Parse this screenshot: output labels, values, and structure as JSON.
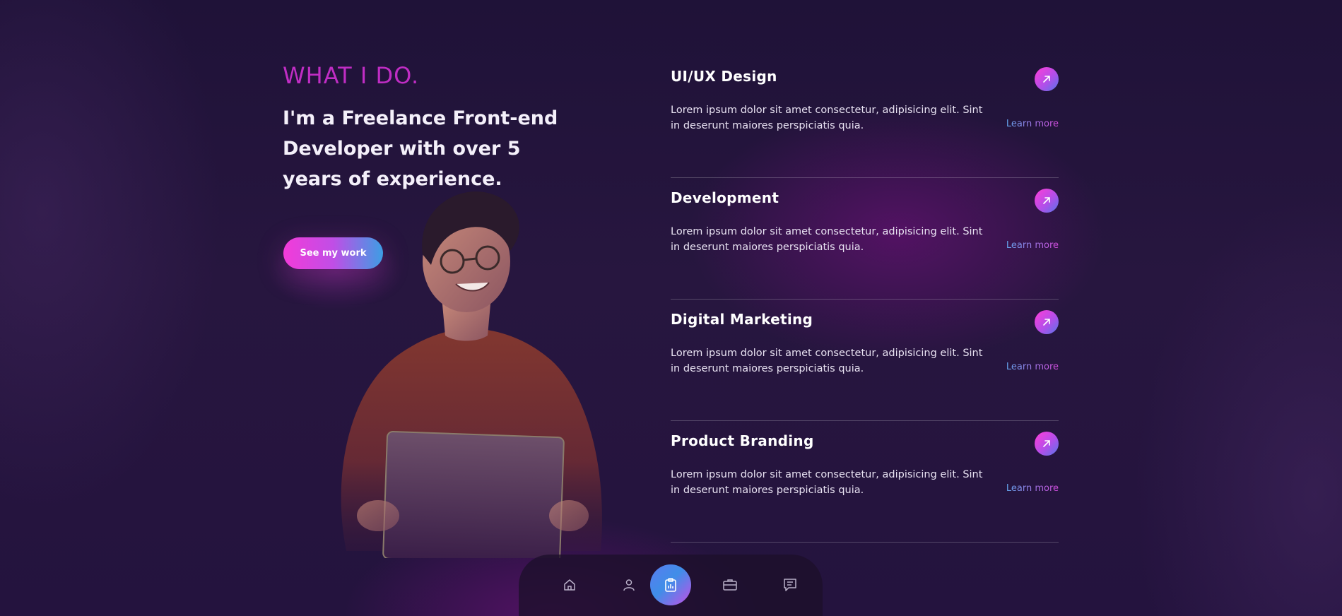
{
  "intro": {
    "section_title": "WHAT I DO.",
    "headline": "I'm a Freelance Front-end Developer with over 5 years of experience.",
    "cta_label": "See my work"
  },
  "services": [
    {
      "title": "UI/UX Design",
      "description": "Lorem ipsum dolor sit amet consectetur, adipisicing elit. Sint in deserunt maiores perspiciatis quia.",
      "link_label": "Learn more"
    },
    {
      "title": "Development",
      "description": "Lorem ipsum dolor sit amet consectetur, adipisicing elit. Sint in deserunt maiores perspiciatis quia.",
      "link_label": "Learn more"
    },
    {
      "title": "Digital Marketing",
      "description": "Lorem ipsum dolor sit amet consectetur, adipisicing elit. Sint in deserunt maiores perspiciatis quia.",
      "link_label": "Learn more"
    },
    {
      "title": "Product Branding",
      "description": "Lorem ipsum dolor sit amet consectetur, adipisicing elit. Sint in deserunt maiores perspiciatis quia.",
      "link_label": "Learn more"
    }
  ],
  "bottom_nav": {
    "items": [
      {
        "icon": "home-icon",
        "active": false
      },
      {
        "icon": "user-icon",
        "active": false
      },
      {
        "icon": "clipboard-chart-icon",
        "active": true
      },
      {
        "icon": "briefcase-icon",
        "active": false
      },
      {
        "icon": "chat-icon",
        "active": false
      }
    ]
  },
  "colors": {
    "accent_pink": "#ff3dd8",
    "accent_blue": "#3d9ee4",
    "title_magenta": "#c02dc4",
    "background": "#23133c"
  }
}
